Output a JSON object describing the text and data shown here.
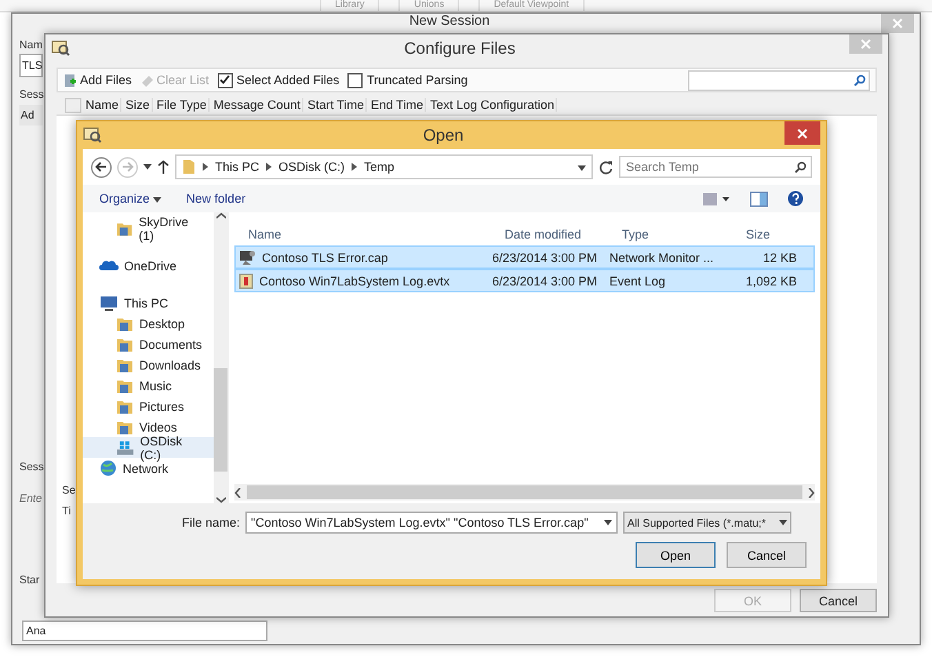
{
  "background_app": {
    "toolbar": [
      {
        "label": "Library"
      },
      {
        "label": "Unions"
      },
      {
        "label": "Default Viewpoint"
      }
    ]
  },
  "new_session": {
    "title": "New Session",
    "name_label": "Nam",
    "name_value": "TLS",
    "session_label": "Sess",
    "session_tab": "Ad",
    "lower_label": "Sess",
    "hint": "Ente",
    "start_label": "Star",
    "start_value": "Ana"
  },
  "configure_files": {
    "title": "Configure Files",
    "add_files": "Add Files",
    "clear_list": {
      "label": "Clear List",
      "disabled": true
    },
    "checkboxes": [
      {
        "label": "Select Added Files",
        "checked": true
      },
      {
        "label": "Truncated Parsing",
        "checked": false
      }
    ],
    "header_checkbox": {
      "checked": false
    },
    "columns": [
      "Name",
      "Size",
      "File Type",
      "Message Count",
      "Start Time",
      "End Time",
      "Text Log Configuration"
    ],
    "side_labels": [
      "Se",
      "Ti"
    ],
    "buttons": [
      {
        "label": "OK",
        "disabled": true
      },
      {
        "label": "Cancel",
        "disabled": false
      }
    ]
  },
  "open_dialog": {
    "title": "Open",
    "breadcrumb": [
      "This PC",
      "OSDisk (C:)",
      "Temp"
    ],
    "search": {
      "placeholder": "Search Temp"
    },
    "commands": [
      "Organize",
      "New folder"
    ],
    "nav": [
      {
        "label": "SkyDrive (1)",
        "kind": "folder",
        "selected": false
      },
      {
        "label": "OneDrive",
        "kind": "cloud",
        "selected": false
      },
      {
        "label": "This PC",
        "kind": "pc",
        "selected": false,
        "children": [
          {
            "label": "Desktop",
            "kind": "folder",
            "selected": false
          },
          {
            "label": "Documents",
            "kind": "folder",
            "selected": false
          },
          {
            "label": "Downloads",
            "kind": "folder",
            "selected": false
          },
          {
            "label": "Music",
            "kind": "folder",
            "selected": false
          },
          {
            "label": "Pictures",
            "kind": "folder",
            "selected": false
          },
          {
            "label": "Videos",
            "kind": "folder",
            "selected": false
          },
          {
            "label": "OSDisk (C:)",
            "kind": "drive",
            "selected": true
          }
        ]
      },
      {
        "label": "Network",
        "kind": "network",
        "selected": false
      }
    ],
    "columns": [
      "Name",
      "Date modified",
      "Type",
      "Size"
    ],
    "files": [
      {
        "name": "Contoso TLS Error.cap",
        "date": "6/23/2014 3:00 PM",
        "type": "Network Monitor ...",
        "size": "12 KB",
        "kind": "capture",
        "selected": true
      },
      {
        "name": "Contoso Win7LabSystem Log.evtx",
        "date": "6/23/2014 3:00 PM",
        "type": "Event Log",
        "size": "1,092 KB",
        "kind": "eventlog",
        "selected": true
      }
    ],
    "file_name_label": "File name:",
    "file_name": "\"Contoso Win7LabSystem Log.evtx\" \"Contoso TLS Error.cap\"",
    "filter": "All Supported Files (*.matu;*",
    "buttons": [
      "Open",
      "Cancel"
    ]
  }
}
